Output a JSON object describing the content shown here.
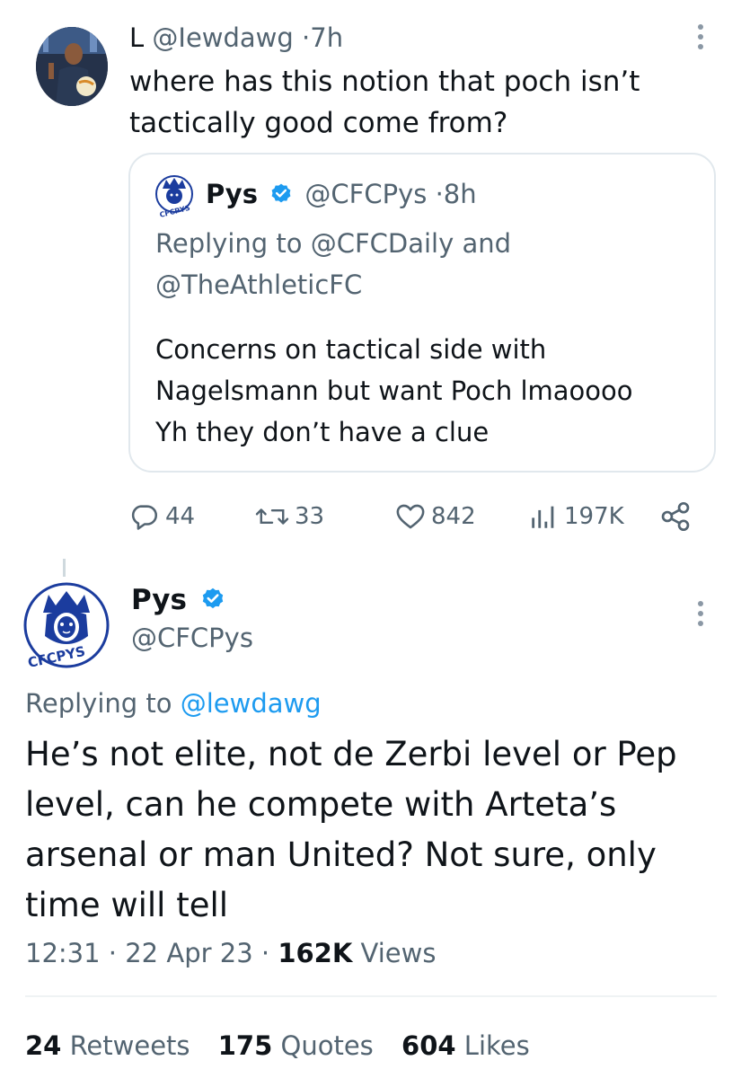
{
  "reply_tweet": {
    "display_name": "L",
    "handle": "@Iewdawg",
    "separator": "·",
    "time": "7h",
    "text": "where has this notion that poch isn’t tactically good come from?",
    "avatar_icon": "user-photo-avatar",
    "more_icon": "more-vertical-icon"
  },
  "quoted_tweet": {
    "display_name": "Pys",
    "verified_icon": "verified-badge-icon",
    "handle": "@CFCPys",
    "separator": "·",
    "time": "8h",
    "replying_prefix": "Replying to",
    "replying_to": "@CFCDaily and @TheAthleticFC",
    "text_line1": "Concerns on tactical side with",
    "text_line2": "Nagelsmann but want Poch lmaoooo",
    "text_line3": "Yh they don’t have a clue",
    "avatar_text": "CFCPYS"
  },
  "actions": {
    "replies": "44",
    "retweets": "33",
    "likes": "842",
    "views": "197K",
    "reply_icon": "reply-icon",
    "retweet_icon": "retweet-icon",
    "like_icon": "heart-icon",
    "views_icon": "views-chart-icon",
    "share_icon": "share-icon"
  },
  "main_tweet": {
    "display_name": "Pys",
    "handle": "@CFCPys",
    "avatar_text": "CFCPYS",
    "replying_prefix": "Replying to",
    "replying_to": "@lewdawg",
    "text": "He’s not elite, not de Zerbi level or Pep level, can he compete with Arteta’s arsenal or man United? Not sure, only time will tell",
    "time": "12:31",
    "separator": "·",
    "date": "22 Apr 23",
    "views_count": "162K",
    "views_label": "Views"
  },
  "stats": {
    "retweets_count": "24",
    "retweets_label": "Retweets",
    "quotes_count": "175",
    "quotes_label": "Quotes",
    "likes_count": "604",
    "likes_label": "Likes"
  },
  "colors": {
    "text": "#0f1419",
    "muted": "#536471",
    "link": "#1d9bf0",
    "verified": "#1d9bf0",
    "border": "#e1e8ed",
    "logo_blue": "#1b3c9e"
  }
}
